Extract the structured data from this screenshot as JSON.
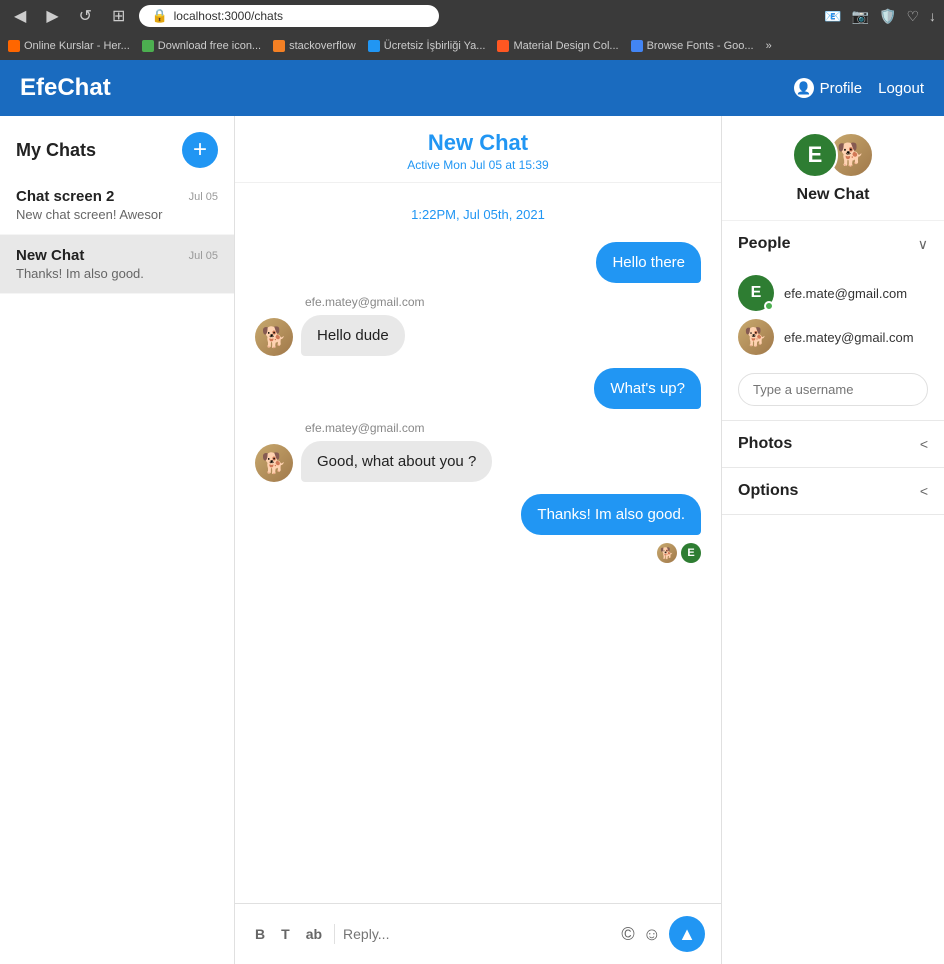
{
  "browser": {
    "url": "localhost:3000/chats",
    "back_btn": "◀",
    "forward_btn": "▶",
    "refresh_btn": "↺",
    "grid_btn": "⊞",
    "bookmarks": [
      {
        "label": "Online Kurslar - Her...",
        "color": "#ff6600"
      },
      {
        "label": "Download free icon...",
        "color": "#4CAF50"
      },
      {
        "label": "stackoverflow",
        "color": "#f48024"
      },
      {
        "label": "Ücretsiz İşbirliği Ya...",
        "color": "#2196F3"
      },
      {
        "label": "Material Design Col...",
        "color": "#FF5722"
      },
      {
        "label": "Browse Fonts - Goo...",
        "color": "#4285F4"
      }
    ],
    "more_label": "»"
  },
  "app": {
    "logo": "EfeChat",
    "header_nav": [
      {
        "label": "Profile",
        "icon": "👤"
      },
      {
        "label": "Logout"
      }
    ]
  },
  "sidebar": {
    "title": "My Chats",
    "add_btn": "+",
    "chats": [
      {
        "name": "Chat screen 2",
        "preview": "New chat screen! Awesor",
        "date": "Jul 05",
        "active": false
      },
      {
        "name": "New Chat",
        "preview": "Thanks! Im also good.",
        "date": "Jul 05",
        "active": true
      }
    ]
  },
  "chat": {
    "name": "New Chat",
    "status": "Active Mon Jul 05 at 15:39",
    "date_divider": "1:22PM, Jul 05th, 2021",
    "messages": [
      {
        "type": "sent",
        "text": "Hello there",
        "sender": null
      },
      {
        "type": "received",
        "text": "Hello dude",
        "sender": "efe.matey@gmail.com"
      },
      {
        "type": "sent",
        "text": "What's up?",
        "sender": null
      },
      {
        "type": "received",
        "text": "Good, what about you ?",
        "sender": "efe.matey@gmail.com"
      },
      {
        "type": "sent",
        "text": "Thanks! Im also good.",
        "sender": null
      }
    ],
    "input_placeholder": "Reply...",
    "format_btns": [
      "B",
      "T",
      "ab",
      "©",
      "☺"
    ]
  },
  "right_panel": {
    "chat_name": "New Chat",
    "sections": {
      "people": {
        "title": "People",
        "chevron": "∨",
        "members": [
          {
            "email": "efe.mate@gmail.com",
            "type": "E",
            "online": true
          },
          {
            "email": "efe.matey@gmail.com",
            "type": "doge",
            "online": false
          }
        ],
        "username_placeholder": "Type a username"
      },
      "photos": {
        "title": "Photos",
        "chevron": "<"
      },
      "options": {
        "title": "Options",
        "chevron": "<"
      }
    }
  }
}
